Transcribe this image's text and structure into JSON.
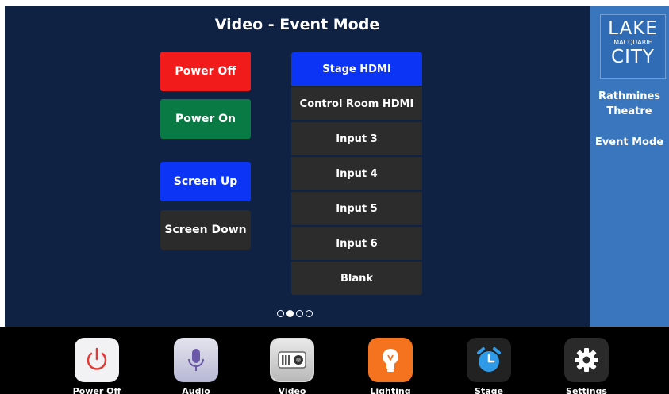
{
  "header": {
    "title": "Video - Event Mode"
  },
  "controls": {
    "power_off": "Power Off",
    "power_on": "Power On",
    "screen_up": "Screen Up",
    "screen_down": "Screen Down"
  },
  "sources": {
    "items": [
      "Stage HDMI",
      "Control Room HDMI",
      "Input 3",
      "Input 4",
      "Input 5",
      "Input 6",
      "Blank"
    ],
    "selected": "Stage HDMI"
  },
  "pager": {
    "total": 4,
    "current": 2
  },
  "sidebar": {
    "logo": {
      "line1": "LAKE",
      "line2": "MACQUARIE",
      "line3": "CITY"
    },
    "venue_line1": "Rathmines",
    "venue_line2": "Theatre",
    "mode": "Event Mode"
  },
  "nav": {
    "items": [
      {
        "label": "Power Off",
        "icon": "power-icon"
      },
      {
        "label": "Audio",
        "icon": "microphone-icon"
      },
      {
        "label": "Video",
        "icon": "projector-icon"
      },
      {
        "label": "Lighting",
        "icon": "lightbulb-icon"
      },
      {
        "label": "Stage",
        "icon": "alarm-clock-icon"
      },
      {
        "label": "Settings",
        "icon": "gear-icon"
      }
    ]
  },
  "colors": {
    "main_bg": "#0f2244",
    "sidebar_bg": "#3a76bd",
    "red": "#f21b1b",
    "green": "#0a7a45",
    "blue": "#0b34f5",
    "dark": "#2b2b2b",
    "lighting_orange": "#f5731e",
    "stage_blue": "#2f9be8"
  }
}
